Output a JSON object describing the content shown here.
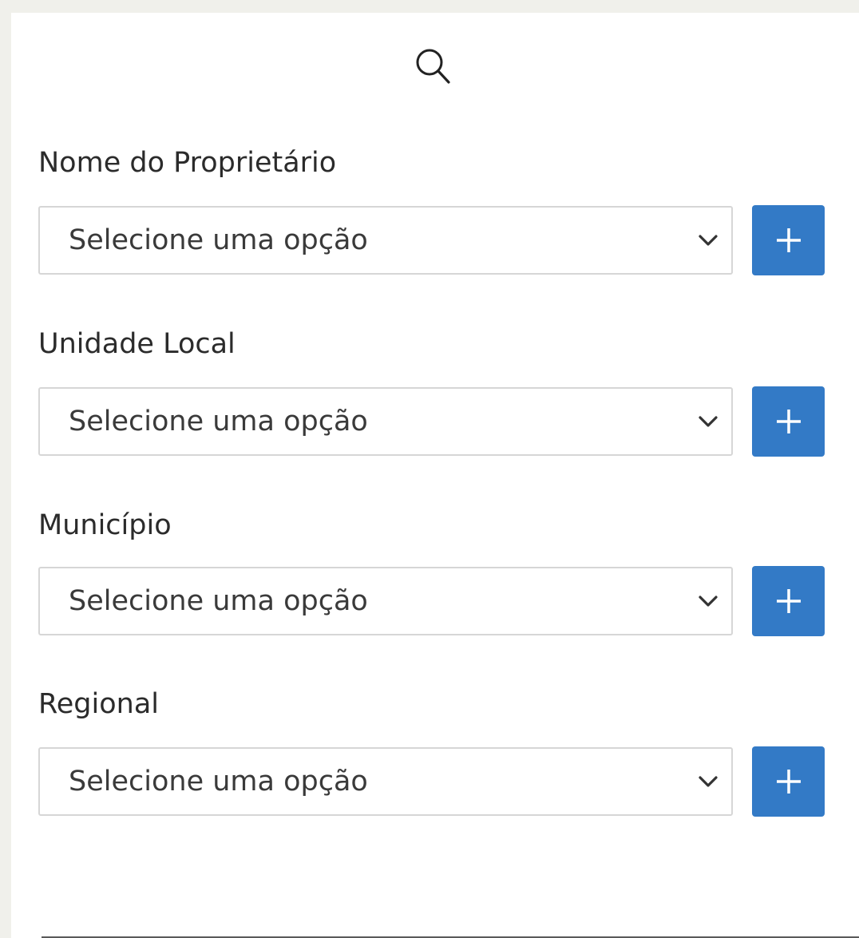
{
  "icons": {
    "search": "search-icon",
    "chevron": "chevron-down-icon",
    "plus": "plus-icon"
  },
  "colors": {
    "accent": "#337ac6",
    "background": "#f0f0eb",
    "panel": "#ffffff",
    "border": "#d6d6d6",
    "text": "#2b2b2b"
  },
  "fields": [
    {
      "label": "Nome do Proprietário",
      "value": "Selecione uma opção"
    },
    {
      "label": "Unidade Local",
      "value": "Selecione uma opção"
    },
    {
      "label": "Município",
      "value": "Selecione uma opção"
    },
    {
      "label": "Regional",
      "value": "Selecione uma opção"
    }
  ]
}
